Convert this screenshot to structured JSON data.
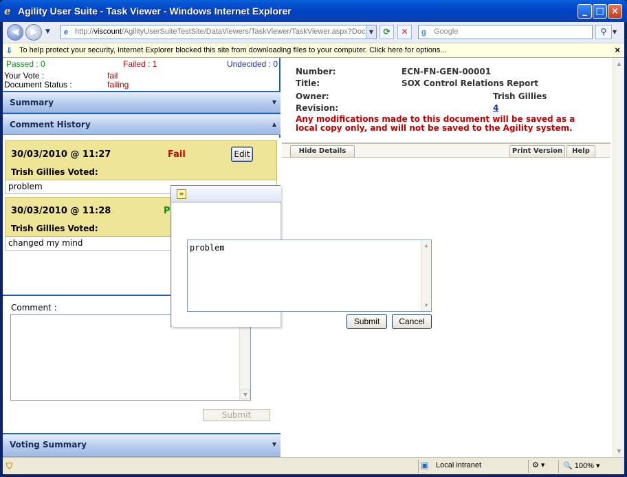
{
  "window": {
    "title": "Agility User Suite - Task Viewer - Windows Internet Explorer",
    "buttons": {
      "minimize": "_",
      "maximize": "□",
      "close": "×"
    }
  },
  "browser": {
    "address_prefix": "http://",
    "address_host": "viscount",
    "address_path": "/AgilityUserSuiteTestSite/DataViewers/TaskViewer/TaskViewer.aspx?Doc",
    "search_placeholder": "Google",
    "infobar_text": "To help protect your security, Internet Explorer blocked this site from downloading files to your computer. Click here for options...",
    "infobar_close": "×"
  },
  "votes": {
    "passed": "Passed : 0",
    "failed": "Failed : 1",
    "undecided": "Undecided : 0",
    "your_vote_label": "Your Vote :",
    "your_vote_value": "fail",
    "doc_status_label": "Document Status :",
    "doc_status_value": "failing"
  },
  "sections": {
    "summary": "Summary",
    "comment_history": "Comment History",
    "voting_summary": "Voting Summary"
  },
  "history": [
    {
      "date": "30/03/2010 @ 11:27",
      "status": "Fail",
      "status_color": "#cc0000",
      "voter": "Trish Gillies Voted:",
      "comment": "problem",
      "edit_label": "Edit"
    },
    {
      "date": "30/03/2010 @ 11:28",
      "status": "P",
      "status_color": "#00930a",
      "voter": "Trish Gillies Voted:",
      "comment": "changed my mind"
    }
  ],
  "comment_form": {
    "label": "Comment :",
    "submit": "Submit"
  },
  "document": {
    "number_label": "Number:",
    "number_value": "ECN-FN-GEN-00001",
    "title_label": "Title:",
    "title_value": "SOX Control Relations Report",
    "owner_label": "Owner:",
    "owner_value": "Trish Gillies",
    "revision_label": "Revision:",
    "revision_value": "4",
    "warning": "Any modifications made to this document will be saved as a local copy only, and will not be saved to the Agility system."
  },
  "toolbar": {
    "hide_details": "Hide Details",
    "print_version": "Print Version",
    "help": "Help"
  },
  "dialog": {
    "text": "problem",
    "submit": "Submit",
    "cancel": "Cancel"
  },
  "statusbar": {
    "zone": "Local intranet",
    "zoom": "100%"
  }
}
